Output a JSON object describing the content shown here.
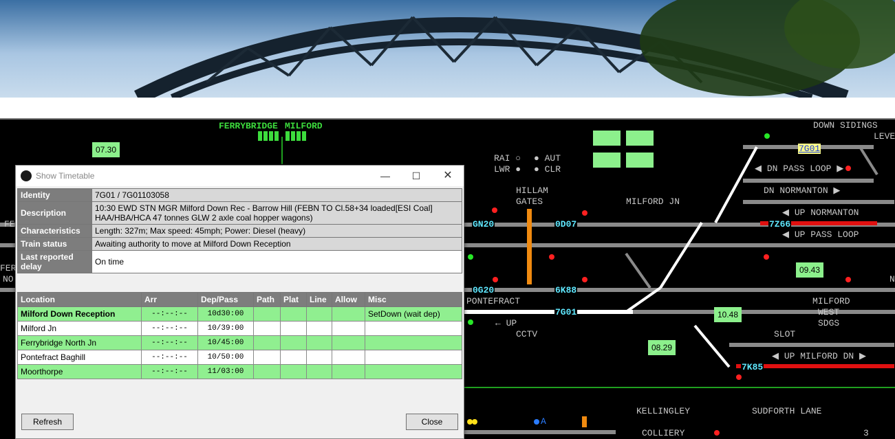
{
  "sim": {
    "panel_labels": {
      "ferrybridge": "FERRYBRIDGE",
      "milford": "MILFORD",
      "hillam": "HILLAM",
      "gates": "GATES",
      "milford_jn": "MILFORD JN",
      "pontefract": "PONTEFRACT",
      "up": "UP",
      "cctv": "CCTV",
      "down_sidings": "DOWN SIDINGS",
      "leve": "LEVE",
      "dn_pass_loop": "DN PASS LOOP",
      "dn_normanton": "DN NORMANTON",
      "up_normanton": "UP NORMANTON",
      "up_pass_loop": "UP PASS LOOP",
      "milford_west": "MILFORD",
      "west": "WEST",
      "sdgs": "SDGS",
      "slot": "SLOT",
      "up_milford_dn": "UP MILFORD DN",
      "kellingley": "KELLINGLEY",
      "colliery": "COLLIERY",
      "sudforth_lane": "SUDFORTH LANE",
      "rai": "RAI",
      "lwr": "LWR",
      "aut": "AUT",
      "clr": "CLR",
      "fe": "FE",
      "fer": "FER",
      "no": "NO",
      "n": "N",
      "digit3": "3",
      "a": "A"
    },
    "clocks": [
      "07.30",
      "09.43",
      "10.48",
      "08.29"
    ],
    "headcodes": [
      "GN20",
      "0D07",
      "0G20",
      "6K88",
      "7G01",
      "7Z66",
      "7K85"
    ],
    "selected_headcode": "7G01"
  },
  "window": {
    "title": "Show Timetable",
    "info": [
      {
        "key": "Identity",
        "value": "7G01 / 7G01103058"
      },
      {
        "key": "Description",
        "value": "10:30 EWD STN MGR Milford Down Rec - Barrow Hill (FEBN TO Cl.58+34 loaded[ESI Coal] HAA/HBA/HCA 47 tonnes GLW 2 axle coal hopper wagons)"
      },
      {
        "key": "Characteristics",
        "value": "Length: 327m; Max speed: 45mph; Power: Diesel (heavy)"
      },
      {
        "key": "Train status",
        "value": "Awaiting authority to move at Milford Down Reception"
      },
      {
        "key": "Last reported delay",
        "value": "On time"
      }
    ],
    "columns": [
      "Location",
      "Arr",
      "Dep/Pass",
      "Path",
      "Plat",
      "Line",
      "Allow",
      "Misc"
    ],
    "rows": [
      {
        "location": "Milford Down Reception",
        "arr": "--:--:--",
        "dep": "10d30:00",
        "path": "",
        "plat": "",
        "line": "",
        "allow": "",
        "misc": "SetDown (wait dep)"
      },
      {
        "location": "Milford Jn",
        "arr": "--:--:--",
        "dep": "10/39:00",
        "path": "",
        "plat": "",
        "line": "",
        "allow": "",
        "misc": ""
      },
      {
        "location": "Ferrybridge North Jn",
        "arr": "--:--:--",
        "dep": "10/45:00",
        "path": "",
        "plat": "",
        "line": "",
        "allow": "",
        "misc": ""
      },
      {
        "location": "Pontefract Baghill",
        "arr": "--:--:--",
        "dep": "10/50:00",
        "path": "",
        "plat": "",
        "line": "",
        "allow": "",
        "misc": ""
      },
      {
        "location": "Moorthorpe",
        "arr": "--:--:--",
        "dep": "11/03:00",
        "path": "",
        "plat": "",
        "line": "",
        "allow": "",
        "misc": ""
      }
    ],
    "refresh_label": "Refresh",
    "close_label": "Close"
  }
}
